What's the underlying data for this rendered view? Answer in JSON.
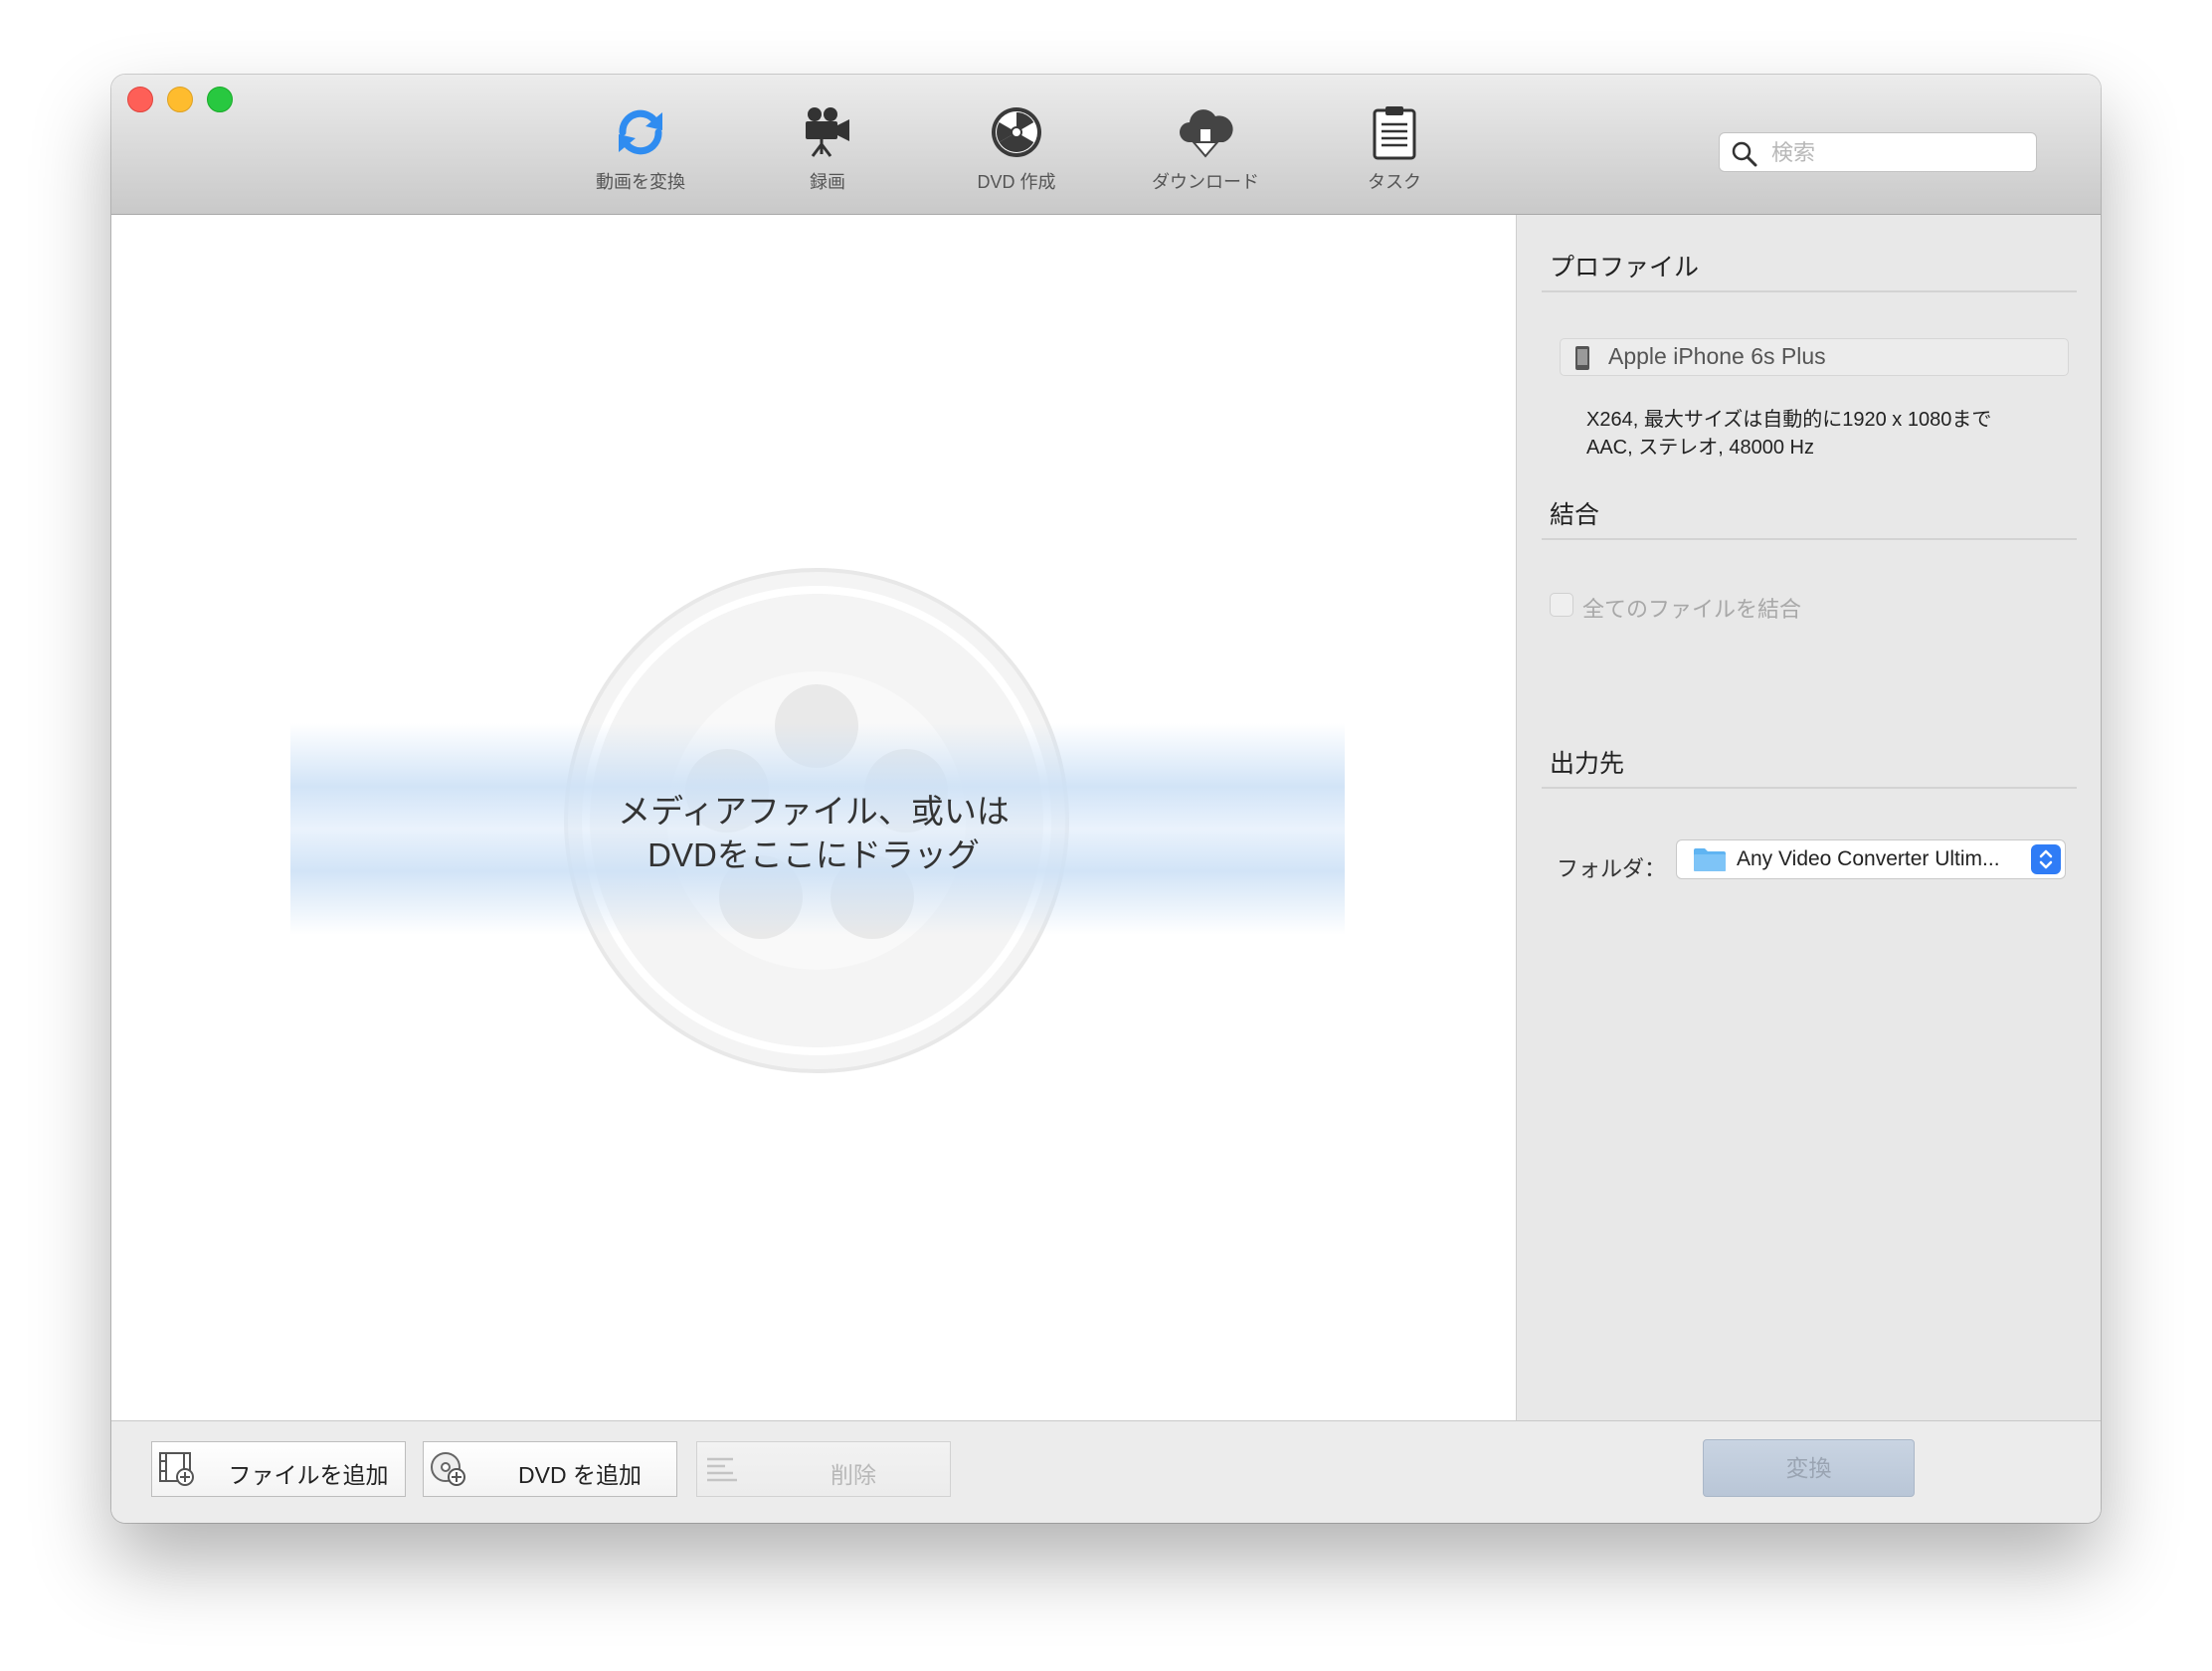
{
  "toolbar": {
    "items": [
      {
        "label": "動画を変換",
        "icon": "convert-refresh-icon"
      },
      {
        "label": "録画",
        "icon": "video-camera-icon"
      },
      {
        "label": "DVD 作成",
        "icon": "dvd-burn-icon"
      },
      {
        "label": "ダウンロード",
        "icon": "cloud-download-icon"
      },
      {
        "label": "タスク",
        "icon": "clipboard-task-icon"
      }
    ],
    "search_placeholder": "検索"
  },
  "dropzone": {
    "line1": "メディアファイル、或いは",
    "line2": "DVDをここにドラッグ"
  },
  "sidebar": {
    "profile_title": "プロファイル",
    "profile_value": "Apple iPhone 6s Plus",
    "profile_desc_line1": "X264, 最大サイズは自動的に1920 x 1080まで",
    "profile_desc_line2": "AAC, ステレオ, 48000 Hz",
    "merge_title": "結合",
    "merge_checkbox_label": "全てのファイルを結合",
    "merge_checked": false,
    "output_title": "出力先",
    "folder_label": "フォルダ：",
    "folder_value": "Any Video Converter Ultim..."
  },
  "bottom": {
    "add_file": "ファイルを追加",
    "add_dvd": "DVD を追加",
    "delete": "削除",
    "convert": "変換"
  },
  "colors": {
    "accent_blue": "#2f7cf6",
    "close": "#fe5f57",
    "minimize": "#febc2e",
    "maximize": "#28c840"
  }
}
